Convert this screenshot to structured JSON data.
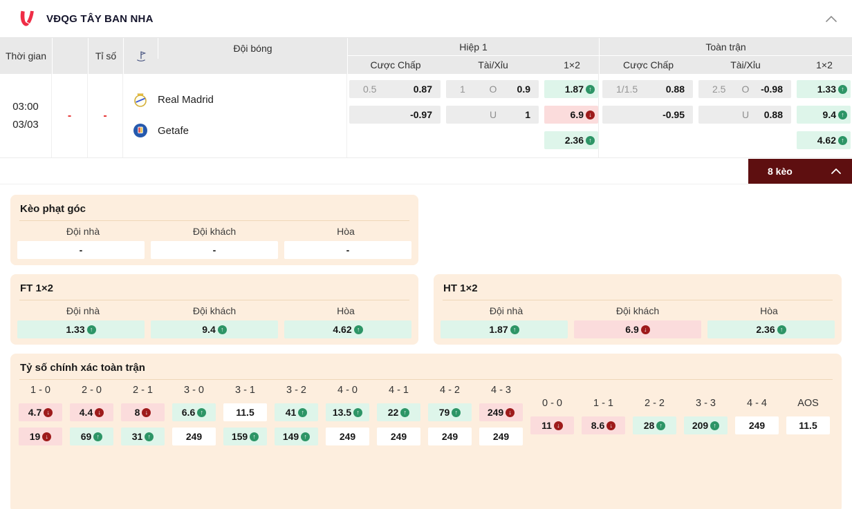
{
  "topbar": {
    "title": "VĐQG TÂY BAN NHA"
  },
  "table_head": {
    "time": "Thời gian",
    "score": "Tỉ số",
    "team": "Đội bóng",
    "group_h1": "Hiệp 1",
    "group_ft": "Toàn trận",
    "handicap": "Cược Chấp",
    "ou": "Tài/Xỉu",
    "x12": "1×2"
  },
  "match": {
    "time": "03:00",
    "date": "03/03",
    "score_home": "-",
    "score_away": "-",
    "home_team": "Real Madrid",
    "away_team": "Getafe",
    "h1": {
      "hdp_line": "0.5",
      "hdp_home": "0.87",
      "hdp_away": "-0.97",
      "ou_line": "1",
      "over_label": "O",
      "over": "0.9",
      "under_label": "U",
      "under": "1",
      "x12_home": "1.87",
      "x12_away": "6.9",
      "x12_draw": "2.36",
      "x12_trends": [
        "up",
        "down",
        "up"
      ]
    },
    "ft": {
      "hdp_line": "1/1.5",
      "hdp_home": "0.88",
      "hdp_away": "-0.95",
      "ou_line": "2.5",
      "over_label": "O",
      "over": "-0.98",
      "under_label": "U",
      "under": "0.88",
      "x12_home": "1.33",
      "x12_away": "9.4",
      "x12_draw": "4.62",
      "x12_trends": [
        "up",
        "up",
        "up"
      ]
    }
  },
  "keo": {
    "label": "8 kèo"
  },
  "corner": {
    "title": "Kèo phạt góc",
    "headers": [
      "Đội nhà",
      "Đội khách",
      "Hòa"
    ],
    "values": [
      "-",
      "-",
      "-"
    ]
  },
  "ft1x2": {
    "title": "FT 1×2",
    "headers": [
      "Đội nhà",
      "Đội khách",
      "Hòa"
    ],
    "values": [
      "1.33",
      "9.4",
      "4.62"
    ],
    "trends": [
      "up",
      "up",
      "up"
    ]
  },
  "ht1x2": {
    "title": "HT 1×2",
    "headers": [
      "Đội nhà",
      "Đội khách",
      "Hòa"
    ],
    "values": [
      "1.87",
      "6.9",
      "2.36"
    ],
    "trends": [
      "up",
      "down",
      "up"
    ]
  },
  "correct_score": {
    "title": "Tỷ số chính xác toàn trận",
    "cols": [
      {
        "label": "1 - 0",
        "r1": "4.7",
        "r1_trend": "down",
        "r2": "19",
        "r2_trend": "down"
      },
      {
        "label": "2 - 0",
        "r1": "4.4",
        "r1_trend": "down",
        "r2": "69",
        "r2_trend": "up"
      },
      {
        "label": "2 - 1",
        "r1": "8",
        "r1_trend": "down",
        "r2": "31",
        "r2_trend": "up"
      },
      {
        "label": "3 - 0",
        "r1": "6.6",
        "r1_trend": "up",
        "r2": "249",
        "r2_trend": "none"
      },
      {
        "label": "3 - 1",
        "r1": "11.5",
        "r1_trend": "none",
        "r2": "159",
        "r2_trend": "up"
      },
      {
        "label": "3 - 2",
        "r1": "41",
        "r1_trend": "up",
        "r2": "149",
        "r2_trend": "up"
      },
      {
        "label": "4 - 0",
        "r1": "13.5",
        "r1_trend": "up",
        "r2": "249",
        "r2_trend": "none"
      },
      {
        "label": "4 - 1",
        "r1": "22",
        "r1_trend": "up",
        "r2": "249",
        "r2_trend": "none"
      },
      {
        "label": "4 - 2",
        "r1": "79",
        "r1_trend": "up",
        "r2": "249",
        "r2_trend": "none"
      },
      {
        "label": "4 - 3",
        "r1": "249",
        "r1_trend": "down",
        "r2": "249",
        "r2_trend": "none"
      }
    ],
    "draws": [
      {
        "label": "0 - 0",
        "value": "11",
        "trend": "down"
      },
      {
        "label": "1 - 1",
        "value": "8.6",
        "trend": "down"
      },
      {
        "label": "2 - 2",
        "value": "28",
        "trend": "up"
      },
      {
        "label": "3 - 3",
        "value": "209",
        "trend": "up"
      },
      {
        "label": "4 - 4",
        "value": "249",
        "trend": "none"
      },
      {
        "label": "AOS",
        "value": "11.5",
        "trend": "none"
      }
    ]
  },
  "colors": {
    "accent_red": "#ef2d46",
    "maroon": "#5e0f10",
    "panel_bg": "#fdeede",
    "green_bg": "#def5ea",
    "red_bg": "#fbdcdc",
    "green_arrow": "#2d9566",
    "red_arrow": "#9e1b1b",
    "header_gray": "#e9e9e9"
  }
}
